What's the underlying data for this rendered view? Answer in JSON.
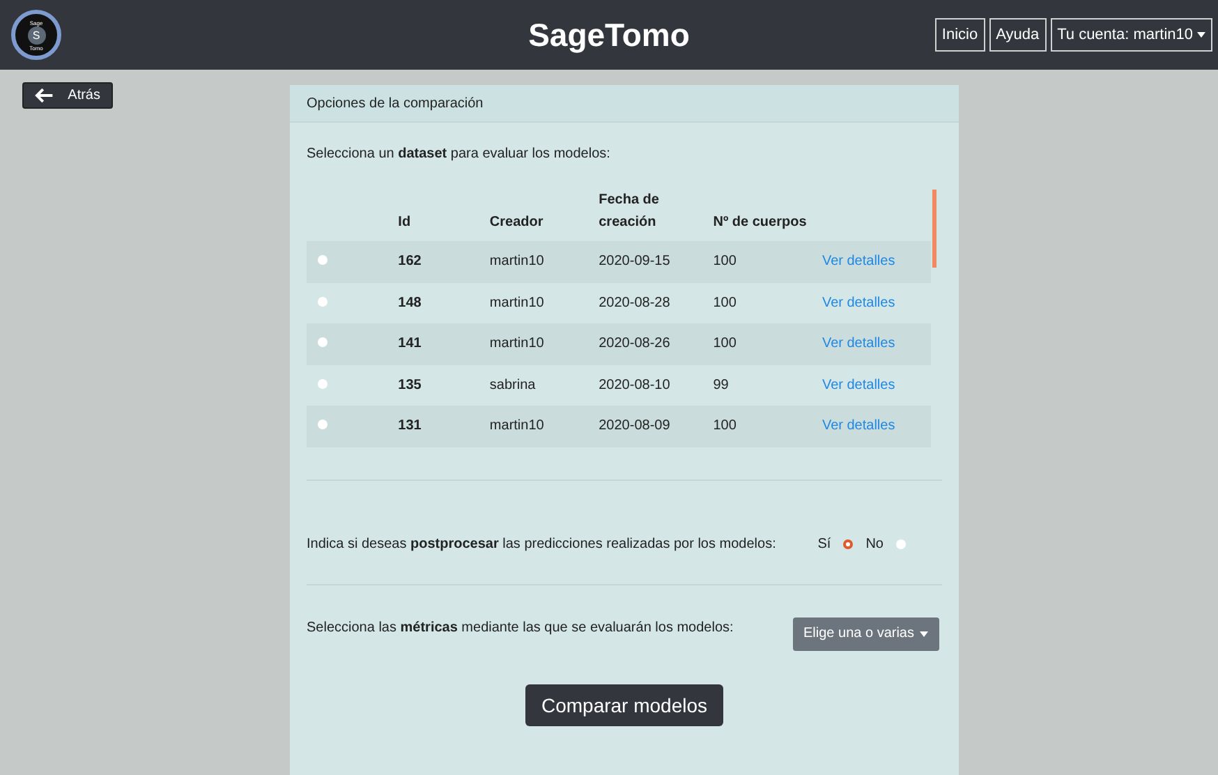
{
  "header": {
    "logo": {
      "top": "Sage",
      "letter": "S",
      "bottom": "Tomo"
    },
    "title": "SageTomo",
    "nav": [
      {
        "label": "Inicio",
        "kind": "link"
      },
      {
        "label": "Ayuda",
        "kind": "link"
      },
      {
        "label": "Tu cuenta: martin10",
        "kind": "dropdown"
      }
    ]
  },
  "back_button": "Atrás",
  "panel": {
    "title": "Opciones de la comparación",
    "dataset_prompt": "Selecciona un **dataset** para evaluar los modelos:",
    "table": {
      "columns": [
        "Id",
        "Creador",
        "Fecha de creación",
        "Nº de cuerpos"
      ],
      "rows": [
        {
          "selected": false,
          "id": "162",
          "creator": "martin10",
          "date": "2020-09-15",
          "bodies": "100",
          "link": "Ver detalles"
        },
        {
          "selected": false,
          "id": "148",
          "creator": "martin10",
          "date": "2020-08-28",
          "bodies": "100",
          "link": "Ver detalles"
        },
        {
          "selected": false,
          "id": "141",
          "creator": "martin10",
          "date": "2020-08-26",
          "bodies": "100",
          "link": "Ver detalles"
        },
        {
          "selected": false,
          "id": "135",
          "creator": "sabrina",
          "date": "2020-08-10",
          "bodies": "99",
          "link": "Ver detalles"
        },
        {
          "selected": false,
          "id": "131",
          "creator": "martin10",
          "date": "2020-08-09",
          "bodies": "100",
          "link": "Ver detalles"
        }
      ]
    },
    "postprocess_prompt": "Indica si deseas **postprocesar** las predicciones realizadas por los modelos:",
    "postprocess_options": [
      {
        "label": "Sí",
        "selected": true
      },
      {
        "label": "No",
        "selected": false
      }
    ],
    "metrics_prompt": "Selecciona las **métricas** mediante las que se evaluarán los modelos:",
    "metrics_dropdown": "Elige una o varias",
    "submit": "Comparar modelos"
  }
}
